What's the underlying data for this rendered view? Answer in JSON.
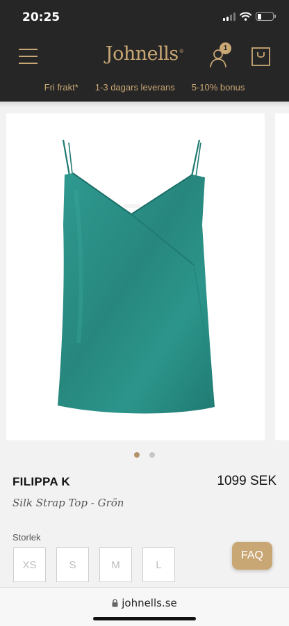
{
  "status_bar": {
    "time": "20:25",
    "battery_level": 0.25
  },
  "header": {
    "logo": "Johnells",
    "logo_mark": "®",
    "account_badge_count": "1"
  },
  "usp": [
    "Fri frakt*",
    "1-3 dagars leverans",
    "5-10% bonus"
  ],
  "gallery": {
    "image_count": 2,
    "active_index": 0
  },
  "product": {
    "brand": "FILIPPA K",
    "price": "1099 SEK",
    "name": "Silk Strap Top - Grön",
    "color": "#2a8f86"
  },
  "size": {
    "label": "Storlek",
    "options": [
      "XS",
      "S",
      "M",
      "L"
    ]
  },
  "faq_label": "FAQ",
  "browser": {
    "url": "johnells.se"
  },
  "colors": {
    "header_bg": "#262626",
    "accent_gold": "#c9a774"
  }
}
